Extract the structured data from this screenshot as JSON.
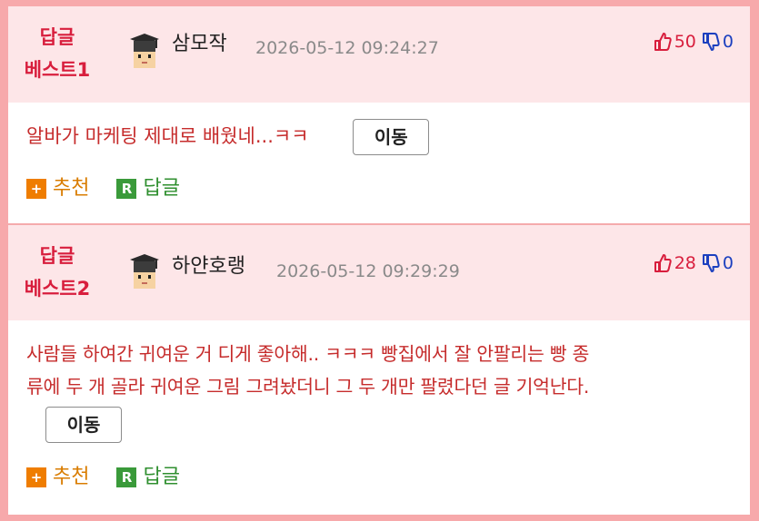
{
  "comments": [
    {
      "best_label_line1": "답글",
      "best_label_line2": "베스트1",
      "nickname": "삼모작",
      "timestamp": "2026-05-12 09:24:27",
      "upvotes": "50",
      "downvotes": "0",
      "text": "알바가 마케팅 제대로 배웠네...ㅋㅋ",
      "move_label": "이동",
      "recommend_label": "추천",
      "reply_label": "답글",
      "recommend_icon": "+",
      "reply_icon": "R"
    },
    {
      "best_label_line1": "답글",
      "best_label_line2": "베스트2",
      "nickname": "하얀호랭",
      "timestamp": "2026-05-12 09:29:29",
      "upvotes": "28",
      "downvotes": "0",
      "text_line1": "사람들 하여간 귀여운 거 디게 좋아해.. ㅋㅋㅋ 빵집에서 잘 안팔리는 빵 종",
      "text_line2": "류에 두 개 골라 귀여운 그림 그려놨더니 그 두 개만 팔렸다던 글 기억난다.",
      "move_label": "이동",
      "recommend_label": "추천",
      "reply_label": "답글",
      "recommend_icon": "+",
      "reply_icon": "R"
    }
  ],
  "icons": {
    "thumbs_up": "thumbs-up-icon",
    "thumbs_down": "thumbs-down-icon",
    "avatar": "graduation-cap-avatar-icon"
  },
  "colors": {
    "best_label": "#d81e3d",
    "header_bg": "#fde6e8",
    "body_text": "#c62c2c",
    "recommend": "#ef7d00",
    "reply": "#3a9a3a",
    "downvote": "#1b3fbf"
  }
}
